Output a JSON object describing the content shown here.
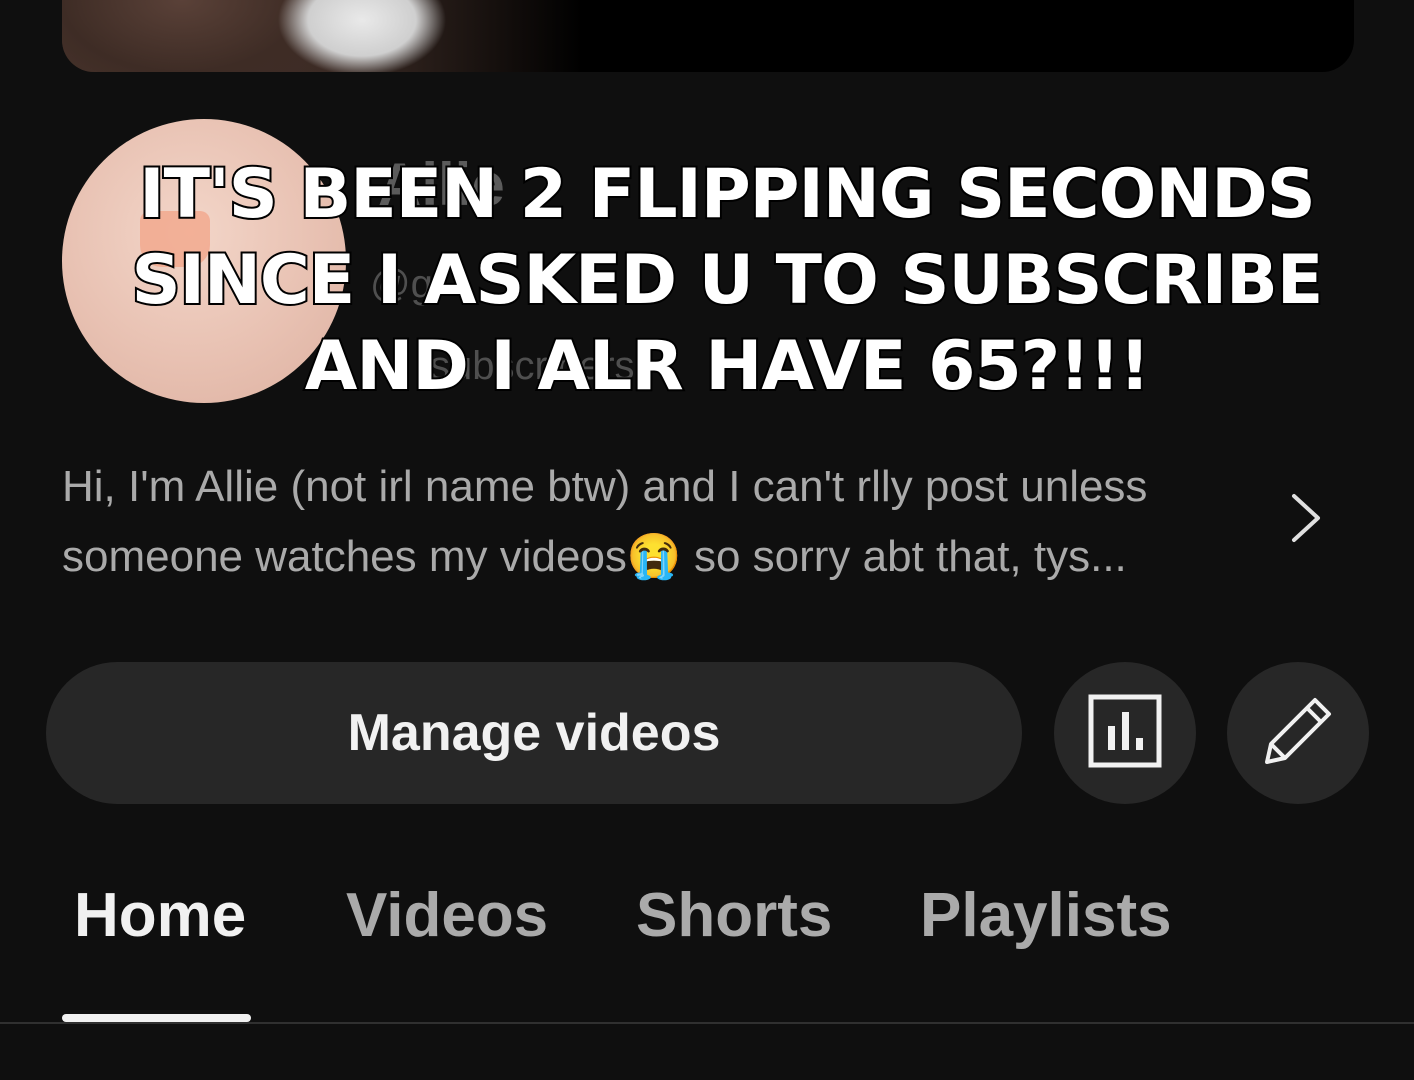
{
  "channel": {
    "name": "Allie",
    "handle": "@g",
    "stats": "subscribers",
    "description": "Hi, I'm Allie (not irl name btw) and I can't rlly post unless someone watches my videos😭 so sorry abt that, tys..."
  },
  "overlay": {
    "lines": [
      "IT'S BEEN 2 FLIPPING SECONDS",
      "SINCE I ASKED U TO SUBSCRIBE",
      "AND I ALR HAVE 65?!!!"
    ]
  },
  "actions": {
    "manage_label": "Manage videos",
    "analytics_icon": "analytics-icon",
    "edit_icon": "pencil-icon"
  },
  "tabs": [
    {
      "label": "Home",
      "active": true
    },
    {
      "label": "Videos",
      "active": false
    },
    {
      "label": "Shorts",
      "active": false
    },
    {
      "label": "Playlists",
      "active": false
    }
  ],
  "colors": {
    "background": "#0f0f0f",
    "button": "#272727",
    "text_primary": "#f1f1f1",
    "text_secondary": "#aaaaaa"
  }
}
